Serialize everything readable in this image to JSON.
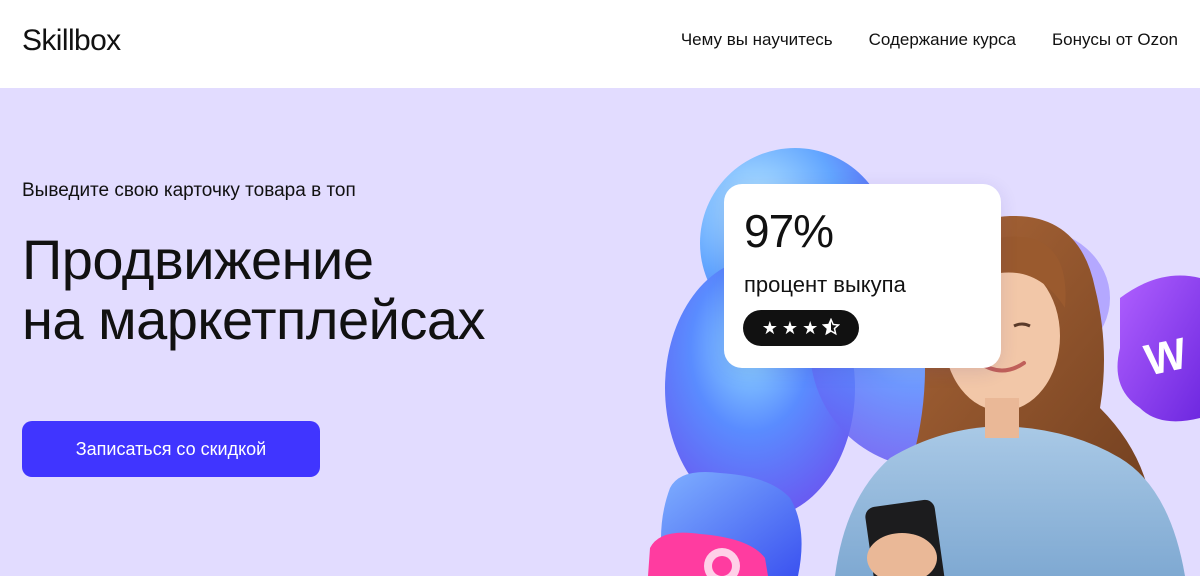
{
  "header": {
    "logo": "Skillbox",
    "nav": [
      {
        "label": "Чему вы научитесь"
      },
      {
        "label": "Содержание курса"
      },
      {
        "label": "Бонусы от Ozon"
      }
    ]
  },
  "hero": {
    "eyebrow": "Выведите свою карточку товара в топ",
    "title_line1": "Продвижение",
    "title_line2": "на маркетплейсах",
    "cta_label": "Записаться со скидкой"
  },
  "stat": {
    "value": "97%",
    "label": "процент выкупа",
    "rating": 3.5,
    "rating_max": 4
  },
  "colors": {
    "hero_bg": "#e2dcff",
    "cta_bg": "#4035ff",
    "blob_blue": "#5a8cff",
    "pillow_purple": "#8a3cf0",
    "pillow_pink": "#ff3ca0"
  },
  "icons": {
    "star": "star-icon",
    "half_star": "half-star-icon"
  }
}
